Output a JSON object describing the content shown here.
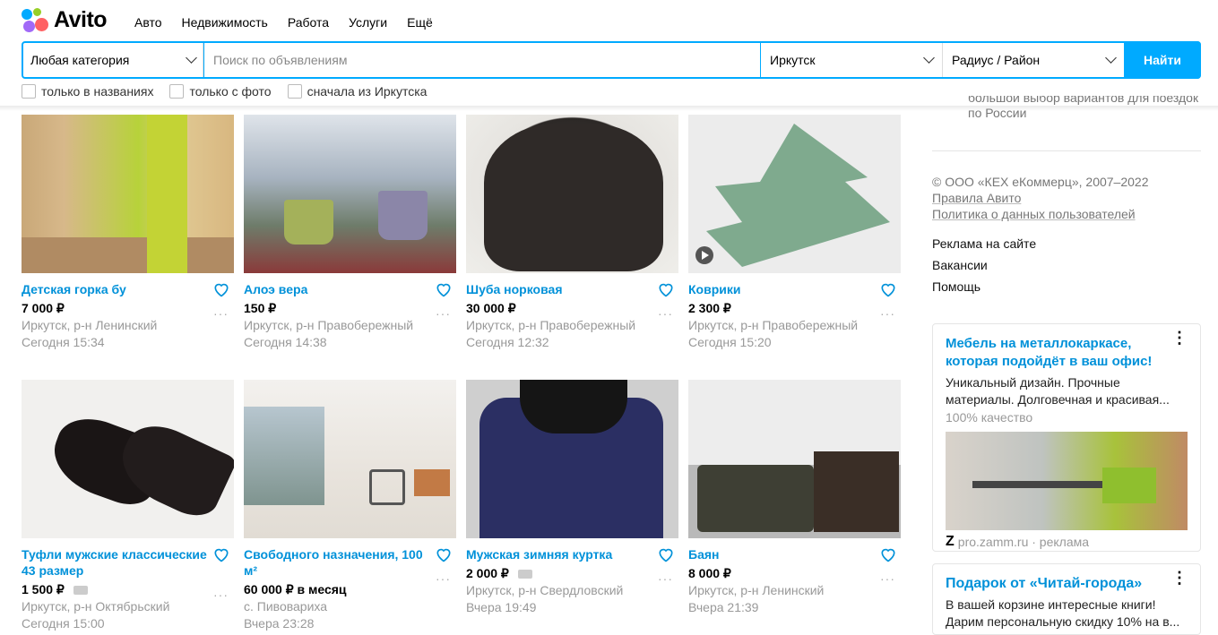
{
  "header": {
    "logo_text": "Avito",
    "nav": [
      "Авто",
      "Недвижимость",
      "Работа",
      "Услуги",
      "Ещё"
    ]
  },
  "search": {
    "category": "Любая категория",
    "placeholder": "Поиск по объявлениям",
    "city": "Иркутск",
    "radius": "Радиус / Район",
    "button": "Найти"
  },
  "filters": [
    "только в названиях",
    "только с фото",
    "сначала из Иркутска"
  ],
  "listings": [
    {
      "title": "Детская горка бу",
      "price": "7 000 ₽",
      "location": "Иркутск, р-н Ленинский",
      "date": "Сегодня 15:34",
      "delivery": false
    },
    {
      "title": "Алоэ вера",
      "price": "150 ₽",
      "location": "Иркутск, р-н Правобережный",
      "date": "Сегодня 14:38",
      "delivery": false
    },
    {
      "title": "Шуба норковая",
      "price": "30 000 ₽",
      "location": "Иркутск, р-н Правобережный",
      "date": "Сегодня 12:32",
      "delivery": false
    },
    {
      "title": "Коврики",
      "price": "2 300 ₽",
      "location": "Иркутск, р-н Правобережный",
      "date": "Сегодня 15:20",
      "delivery": false
    },
    {
      "title": "Туфли мужские классические 43 размер",
      "price": "1 500 ₽",
      "location": "Иркутск, р-н Октябрьский",
      "date": "Сегодня 15:00",
      "delivery": true
    },
    {
      "title": "Свободного назначения, 100 м²",
      "price": "60 000 ₽ в месяц",
      "location": "с. Пивовариха",
      "date": "Вчера 23:28",
      "delivery": false
    },
    {
      "title": "Мужская зимняя куртка",
      "price": "2 000 ₽",
      "location": "Иркутск, р-н Свердловский",
      "date": "Вчера 19:49",
      "delivery": true
    },
    {
      "title": "Баян",
      "price": "8 000 ₽",
      "location": "Иркутск, р-н Ленинский",
      "date": "Вчера 21:39",
      "delivery": false
    }
  ],
  "sidebar": {
    "cut_text_1": "большой выбор вариантов для поездок",
    "cut_text_2": "по России",
    "copyright": "© ООО «КЕХ еКоммерц», 2007–2022",
    "rules": "Правила Авито",
    "privacy": "Политика о данных пользователей",
    "links": [
      "Реклама на сайте",
      "Вакансии",
      "Помощь"
    ],
    "ad1": {
      "title": "Мебель на металлокаркасе, которая подойдёт в ваш офис!",
      "text": "Уникальный дизайн. Прочные материалы. Долговечная и красивая...",
      "quality": "100% качество",
      "source": "pro.zamm.ru · реклама"
    },
    "ad2": {
      "title": "Подарок от «Читай-города»",
      "text": "В вашей корзине интересные книги! Дарим персональную скидку 10% на в..."
    }
  },
  "colors": {
    "accent": "#00aaff",
    "link": "#0091d9"
  }
}
